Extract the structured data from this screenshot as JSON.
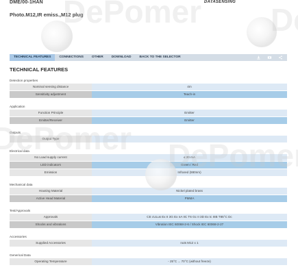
{
  "header": {
    "model": "DME/00-1HAN",
    "subtitle": "Photo.M12,IR emiss.,M12 plug",
    "brand": "DATASENSING"
  },
  "tabs": [
    {
      "label": "TECHNICAL FEATURES"
    },
    {
      "label": "CONNECTIONS"
    },
    {
      "label": "OTHER"
    },
    {
      "label": "DOWNLOAD"
    },
    {
      "label": "BACK TO THE SELECTOR"
    }
  ],
  "icons": [
    "download-icon",
    "video-icon",
    "share-icon"
  ],
  "section_title": "TECHNICAL FEATURES",
  "groups": [
    {
      "title": "Detection properties",
      "rows": [
        {
          "label": "Nominal sensing distance",
          "value": "4m"
        },
        {
          "label": "Sensitivity adjustment",
          "value": "Teach-in"
        }
      ]
    },
    {
      "title": "Application",
      "rows": [
        {
          "label": "Function Principle",
          "value": "Emitter"
        },
        {
          "label": "Emitter/Receiver",
          "value": "Emitter"
        }
      ]
    },
    {
      "title": "Outputs",
      "rows": [
        {
          "label": "Output Type",
          "value": ""
        }
      ]
    },
    {
      "title": "Electrical data",
      "rows": [
        {
          "label": "No Load supply current",
          "value": "≤ 20 mA"
        },
        {
          "label": "LED indicators",
          "value": "Green / Red"
        },
        {
          "label": "Emission",
          "value": "Infrared (880nm)"
        }
      ]
    },
    {
      "title": "Mechanical data",
      "rows": [
        {
          "label": "Housing Material",
          "value": "Nickel plated brass"
        },
        {
          "label": "Active Head Material",
          "value": "PMMA"
        }
      ]
    },
    {
      "title": "Test/Approvals",
      "rows": [
        {
          "label": "Approvals",
          "value": "CE cULus Ex II 3G Ex nA IIC T6 Gc II 3D Ex tc IIIB T85°C Dc"
        },
        {
          "label": "Shocks and vibrations",
          "value": "Vibration IEC 60068-2-6 / Shock IEC 60068-2-27"
        }
      ]
    },
    {
      "title": "Accessories",
      "rows": [
        {
          "label": "Supplied Accessories",
          "value": "nuts M12 x 1"
        }
      ]
    },
    {
      "title": "Generical Data",
      "rows": [
        {
          "label": "Operating Temperature",
          "value": "- 25°C ... 70°C (without freeze)"
        }
      ]
    }
  ],
  "watermarks": [
    "DePomer",
    "DePomer",
    "DePomer",
    "DePomer"
  ],
  "colors": {
    "tab_bar": "#d4dde6",
    "tab_active": "#a9c8e6",
    "row_value_light": "#dde9f5",
    "row_value_dark": "#a6cce8",
    "row_label_light": "#e6e6e6",
    "row_label_dark": "#c9c9c9"
  }
}
